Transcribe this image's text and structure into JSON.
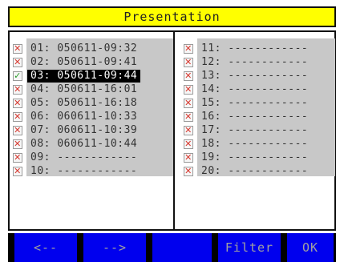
{
  "title": "Presentation",
  "left_list": [
    {
      "index": "01:",
      "value": "050611-09:32",
      "checked": false,
      "selected": false
    },
    {
      "index": "02:",
      "value": "050611-09:41",
      "checked": false,
      "selected": false
    },
    {
      "index": "03:",
      "value": "050611-09:44",
      "checked": true,
      "selected": true
    },
    {
      "index": "04:",
      "value": "050611-16:01",
      "checked": false,
      "selected": false
    },
    {
      "index": "05:",
      "value": "050611-16:18",
      "checked": false,
      "selected": false
    },
    {
      "index": "06:",
      "value": "060611-10:33",
      "checked": false,
      "selected": false
    },
    {
      "index": "07:",
      "value": "060611-10:39",
      "checked": false,
      "selected": false
    },
    {
      "index": "08:",
      "value": "060611-10:44",
      "checked": false,
      "selected": false
    },
    {
      "index": "09:",
      "value": "------------",
      "checked": false,
      "selected": false
    },
    {
      "index": "10:",
      "value": "------------",
      "checked": false,
      "selected": false
    }
  ],
  "right_list": [
    {
      "index": "11:",
      "value": "------------",
      "checked": false
    },
    {
      "index": "12:",
      "value": "------------",
      "checked": false
    },
    {
      "index": "13:",
      "value": "------------",
      "checked": false
    },
    {
      "index": "14:",
      "value": "------------",
      "checked": false
    },
    {
      "index": "15:",
      "value": "------------",
      "checked": false
    },
    {
      "index": "16:",
      "value": "------------",
      "checked": false
    },
    {
      "index": "17:",
      "value": "------------",
      "checked": false
    },
    {
      "index": "18:",
      "value": "------------",
      "checked": false
    },
    {
      "index": "19:",
      "value": "------------",
      "checked": false
    },
    {
      "index": "20:",
      "value": "------------",
      "checked": false
    }
  ],
  "buttons": {
    "prev": "<--",
    "next": "-->",
    "blank": "",
    "filter": "Filter",
    "ok": "OK"
  },
  "icons": {
    "unchecked": "x-checkbox-icon",
    "checked": "check-checkbox-icon"
  },
  "colors": {
    "title_bg": "#ffff00",
    "button_bg": "#0000ee",
    "list_bg": "#c8c8c8",
    "unchecked": "#d6372e",
    "checked": "#2a9d2a"
  }
}
